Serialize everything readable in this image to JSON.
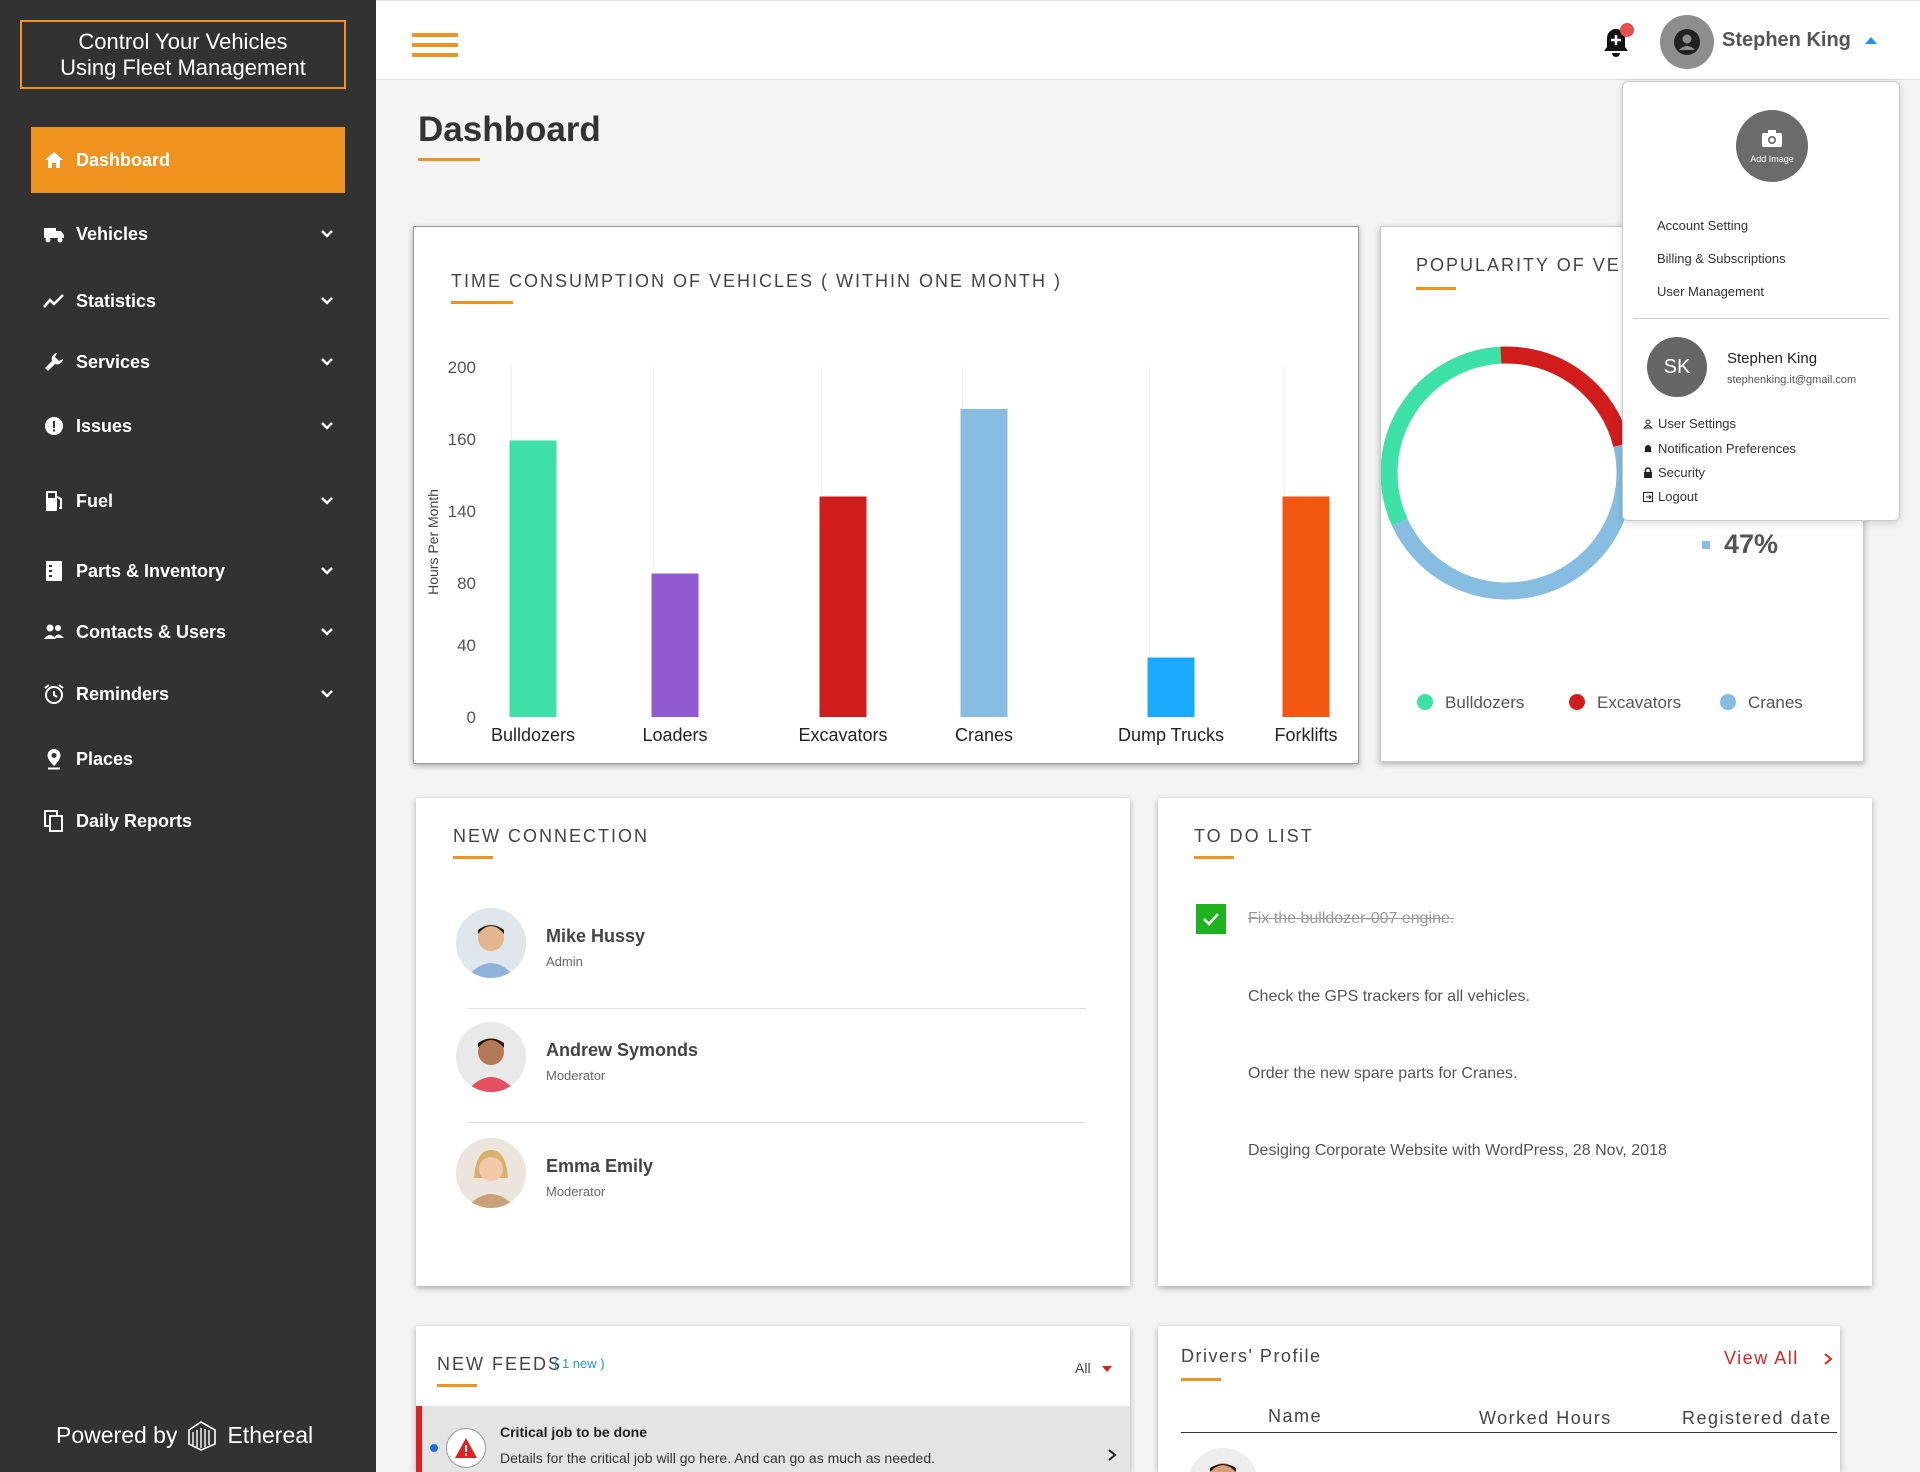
{
  "brand": {
    "title": "Control Your Vehicles\nUsing Fleet Management"
  },
  "nav": {
    "items": [
      {
        "label": "Dashboard",
        "icon": "home-icon",
        "active": true
      },
      {
        "label": "Vehicles",
        "icon": "truck-icon"
      },
      {
        "label": "Statistics",
        "icon": "chart-line-icon"
      },
      {
        "label": "Services",
        "icon": "wrench-icon"
      },
      {
        "label": "Issues",
        "icon": "alert-circle-icon"
      },
      {
        "label": "Fuel",
        "icon": "fuel-pump-icon"
      },
      {
        "label": "Parts & Inventory",
        "icon": "clipboard-icon"
      },
      {
        "label": "Contacts & Users",
        "icon": "users-icon"
      },
      {
        "label": "Reminders",
        "icon": "alarm-clock-icon"
      },
      {
        "label": "Places",
        "icon": "map-pin-icon"
      },
      {
        "label": "Daily Reports",
        "icon": "copy-icon"
      }
    ]
  },
  "footer": {
    "powered_by": "Powered by",
    "company": "Ethereal"
  },
  "topbar": {
    "user_name": "Stephen King"
  },
  "page": {
    "title": "Dashboard"
  },
  "colors": {
    "accent": "#f0921e",
    "sidebar": "#323232"
  },
  "time_chart": {
    "title": "TIME CONSUMPTION OF VEHICLES ( WITHIN ONE MONTH )"
  },
  "chart_data": [
    {
      "type": "bar",
      "title": "TIME CONSUMPTION OF VEHICLES ( WITHIN ONE MONTH )",
      "ylabel": "Hours Per Month",
      "xlabel": "",
      "categories": [
        "Bulldozers",
        "Loaders",
        "Excavators",
        "Cranes",
        "Dump Trucks",
        "Forklifts"
      ],
      "values": [
        158,
        82,
        126,
        176,
        34,
        126
      ],
      "colors": [
        "#3de0a7",
        "#905ad0",
        "#d11c1c",
        "#86bde0",
        "#1aabff",
        "#f4570f"
      ],
      "yticks": [
        "0",
        "40",
        "80",
        "140",
        "160",
        "200"
      ],
      "ylim": [
        0,
        200
      ],
      "grid": false
    },
    {
      "type": "pie",
      "title": "POPULARITY OF VEHI",
      "categories": [
        "Bulldozers",
        "Excavators",
        "Cranes"
      ],
      "values": [
        31,
        22,
        47
      ],
      "colors": [
        "#3de0a7",
        "#d11c1c",
        "#86bde0"
      ],
      "visible_label": "47%",
      "legend": "bottom"
    }
  ],
  "connections": {
    "title": "NEW CONNECTION",
    "people": [
      {
        "name": "Mike Hussy",
        "role": "Admin"
      },
      {
        "name": "Andrew Symonds",
        "role": "Moderator"
      },
      {
        "name": "Emma Emily",
        "role": "Moderator"
      }
    ]
  },
  "todo": {
    "title": "TO DO LIST",
    "items": [
      {
        "text": "Fix the bulldozer-007 engine.",
        "done": true
      },
      {
        "text": "Check the GPS trackers for all vehicles.",
        "done": false
      },
      {
        "text": "Order the new spare parts for Cranes.",
        "done": false
      },
      {
        "text": "Desiging Corporate Website with WordPress, 28 Nov, 2018",
        "done": false
      }
    ]
  },
  "feeds": {
    "title": "NEW FEEDS",
    "badge": "( 1 new )",
    "filter": "All",
    "item": {
      "title": "Critical job to be done",
      "desc": "Details for the critical job will go here. And can go as much as needed."
    }
  },
  "drivers": {
    "title": "Drivers' Profile",
    "view_all": "View All",
    "columns": [
      "Name",
      "Worked Hours",
      "Registered date"
    ]
  },
  "dropdown": {
    "add_image": "Add Image",
    "menu": [
      "Account Setting",
      "Billing & Subscriptions",
      "User Management"
    ],
    "initials": "SK",
    "name": "Stephen King",
    "email": "stephenking.it@gmail.com",
    "links": [
      {
        "label": "User Settings",
        "icon": "user-icon"
      },
      {
        "label": "Notification Preferences",
        "icon": "bell-icon"
      },
      {
        "label": "Security",
        "icon": "lock-icon"
      },
      {
        "label": "Logout",
        "icon": "logout-icon"
      }
    ]
  }
}
